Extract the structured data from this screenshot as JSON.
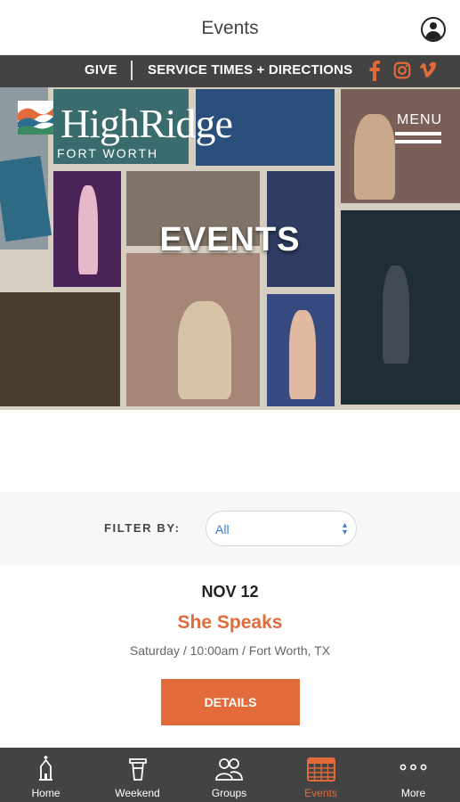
{
  "app_bar": {
    "title": "Events"
  },
  "site_nav": {
    "give": "GIVE",
    "service_times": "SERVICE TIMES + DIRECTIONS",
    "social_icons": [
      "facebook-icon",
      "instagram-icon",
      "vimeo-icon"
    ],
    "icon_color": "#e36a3a"
  },
  "hero": {
    "brand": "HighRidge",
    "city": "FORT WORTH",
    "menu_label": "MENU",
    "title": "EVENTS"
  },
  "filter": {
    "label": "FILTER BY:",
    "selected": "All"
  },
  "event": {
    "date": "NOV 12",
    "name": "She Speaks",
    "meta": "Saturday / 10:00am / Fort Worth, TX",
    "details_label": "DETAILS"
  },
  "tabs": [
    {
      "label": "Home",
      "icon": "church-icon"
    },
    {
      "label": "Weekend",
      "icon": "podium-icon"
    },
    {
      "label": "Groups",
      "icon": "group-icon"
    },
    {
      "label": "Events",
      "icon": "calendar-icon",
      "active": true
    },
    {
      "label": "More",
      "icon": "more-icon"
    }
  ],
  "colors": {
    "accent": "#e36a3a",
    "dark_bar": "#434343",
    "link_blue": "#3a7bd5"
  }
}
